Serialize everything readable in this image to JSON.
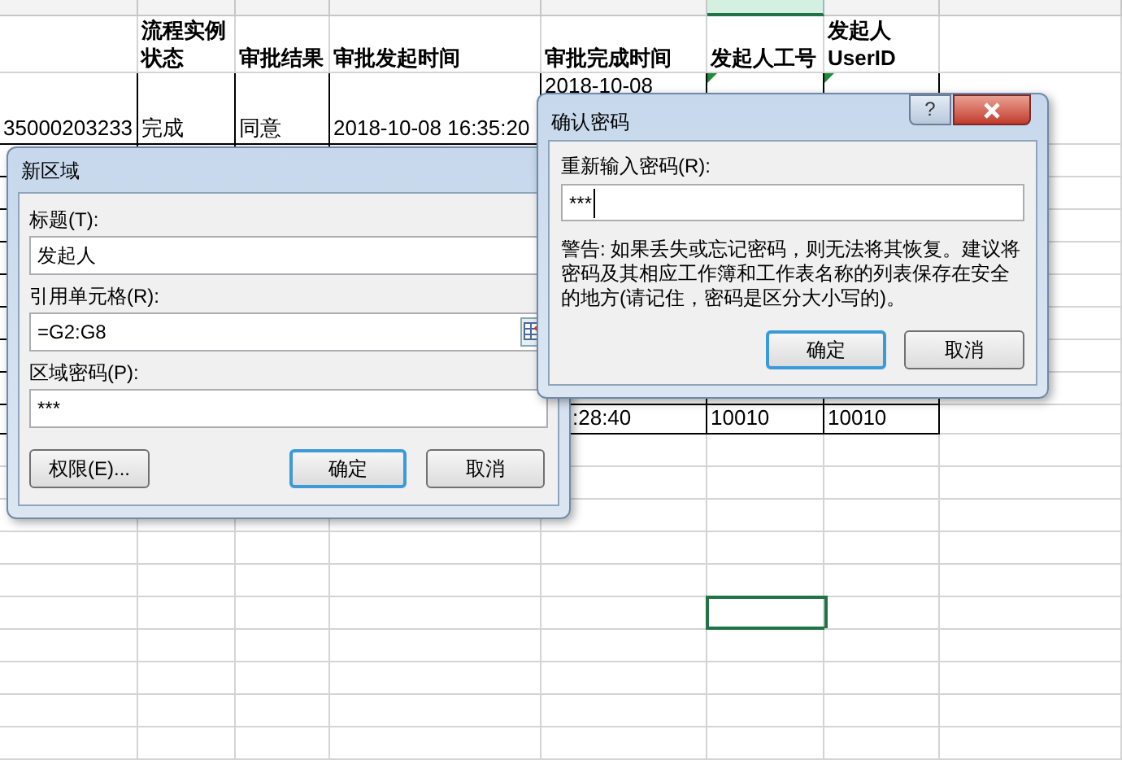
{
  "sheet": {
    "column_letters": [
      {
        "selected": false
      },
      {
        "selected": false
      },
      {
        "selected": false
      },
      {
        "selected": false
      },
      {
        "selected": false
      },
      {
        "selected": true
      },
      {
        "selected": false
      },
      {
        "selected": false
      }
    ],
    "header_row": {
      "B": "流程实例状态",
      "C": "审批结果",
      "D": "审批发起时间",
      "E": "审批完成时间",
      "F": "发起人工号",
      "G": "发起人 UserID"
    },
    "rows": [
      {
        "cells": {
          "A": {
            "text": "35000203233"
          },
          "B": {
            "text": "完成"
          },
          "C": {
            "text": "同意"
          },
          "D": {
            "text": "2018-10-08 16:35:20"
          },
          "E": {
            "text": "2018-10-08"
          },
          "F": {
            "flagged": true
          },
          "G": {
            "flagged": true
          }
        }
      },
      {
        "cells": {
          "E": {
            "text": ":28:40"
          },
          "F": {
            "text": "10010"
          },
          "G": {
            "text": "10010"
          }
        }
      },
      {
        "cells": {
          "F": {
            "selected": true
          }
        }
      }
    ]
  },
  "new_range_dialog": {
    "title": "新区域",
    "fields": [
      {
        "label": "标题(T):",
        "value": "发起人"
      },
      {
        "label": "引用单元格(R):",
        "value": "=G2:G8",
        "kind": "range"
      },
      {
        "label": "区域密码(P):",
        "value": "***"
      }
    ],
    "buttons": [
      {
        "label": "权限(E)...",
        "default": false
      },
      {
        "label": "确定",
        "default": true
      },
      {
        "label": "取消",
        "default": false
      }
    ]
  },
  "confirm_dialog": {
    "title": "确认密码",
    "help": "?",
    "field": {
      "label": "重新输入密码(R):",
      "value": "***"
    },
    "warning": "警告: 如果丢失或忘记密码，则无法将其恢复。建议将密码及其相应工作簿和工作表名称的列表保存在安全的地方(请记住，密码是区分大小写的)。",
    "buttons": [
      {
        "label": "确定",
        "default": true
      },
      {
        "label": "取消",
        "default": false
      }
    ]
  }
}
